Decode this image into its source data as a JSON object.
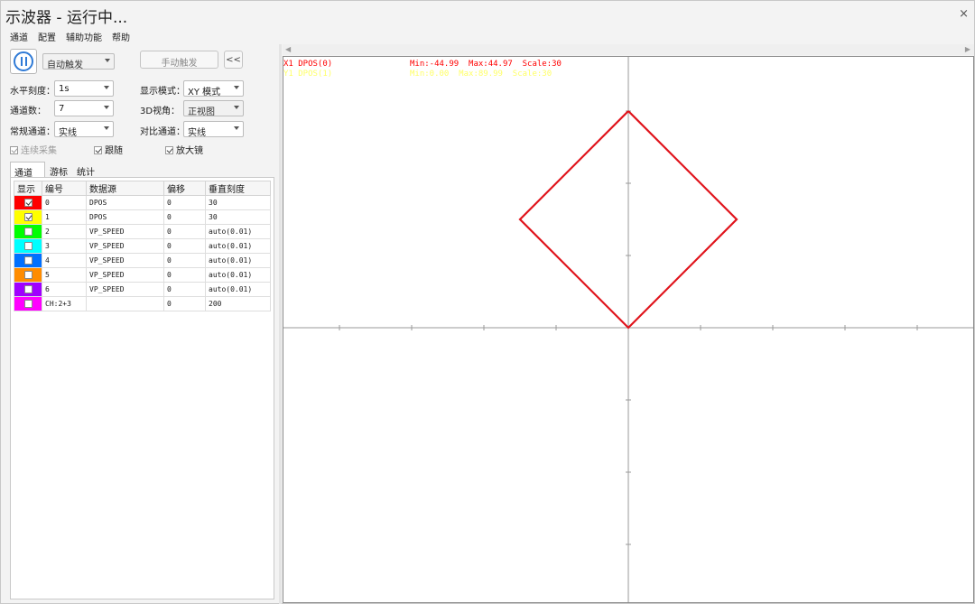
{
  "window": {
    "title": "示波器 - 运行中...",
    "close_glyph": "×"
  },
  "menu": [
    "通道",
    "配置",
    "辅助功能",
    "帮助"
  ],
  "toolbar": {
    "trigger_mode": "自动触发",
    "manual_trigger": "手动触发",
    "collapse": "<<"
  },
  "settings": {
    "h_scale_label": "水平刻度：",
    "h_scale_value": "1s",
    "display_mode_label": "显示模式：",
    "display_mode_value": "XY 模式",
    "channel_count_label": "通道数：",
    "channel_count_value": "7",
    "view3d_label": "3D视角：",
    "view3d_value": "正视图",
    "normal_channel_label": "常规通道：",
    "normal_channel_value": "实线",
    "compare_channel_label": "对比通道：",
    "compare_channel_value": "实线"
  },
  "options": {
    "continuous": "连续采集",
    "follow": "跟随",
    "magnifier": "放大镜"
  },
  "tabs": [
    "通道号",
    "游标",
    "统计"
  ],
  "table": {
    "headers": [
      "显示",
      "编号",
      "数据源",
      "偏移",
      "垂直刻度"
    ],
    "rows": [
      {
        "color": "#ff0000",
        "checked": true,
        "id": "0",
        "source": "DPOS",
        "offset": "0",
        "scale": "30"
      },
      {
        "color": "#ffff00",
        "checked": true,
        "id": "1",
        "source": "DPOS",
        "offset": "0",
        "scale": "30"
      },
      {
        "color": "#00ff00",
        "checked": false,
        "id": "2",
        "source": "VP_SPEED",
        "offset": "0",
        "scale": "auto(0.01)"
      },
      {
        "color": "#00ffff",
        "checked": false,
        "id": "3",
        "source": "VP_SPEED",
        "offset": "0",
        "scale": "auto(0.01)"
      },
      {
        "color": "#0070ff",
        "checked": false,
        "id": "4",
        "source": "VP_SPEED",
        "offset": "0",
        "scale": "auto(0.01)"
      },
      {
        "color": "#ff8c00",
        "checked": false,
        "id": "5",
        "source": "VP_SPEED",
        "offset": "0",
        "scale": "auto(0.01)"
      },
      {
        "color": "#a000ff",
        "checked": false,
        "id": "6",
        "source": "VP_SPEED",
        "offset": "0",
        "scale": "auto(0.01)"
      },
      {
        "color": "#ff00ff",
        "checked": false,
        "id": "CH:2+3",
        "source": "",
        "offset": "0",
        "scale": "200"
      }
    ]
  },
  "scope": {
    "line1": {
      "name": "X1 DPOS(0)",
      "minmax": "Min:-44.99  Max:44.97  Scale:30",
      "color": "#ff0000"
    },
    "line2": {
      "name": "Y1 DPOS(1)",
      "minmax": "Min:0.00  Max:89.99  Scale:30",
      "color": "#ffff66"
    },
    "trace_color": "#e0141c",
    "trace": [
      [
        0,
        90
      ],
      [
        45,
        45
      ],
      [
        0,
        0
      ],
      [
        -45,
        45
      ],
      [
        0,
        90
      ]
    ]
  }
}
